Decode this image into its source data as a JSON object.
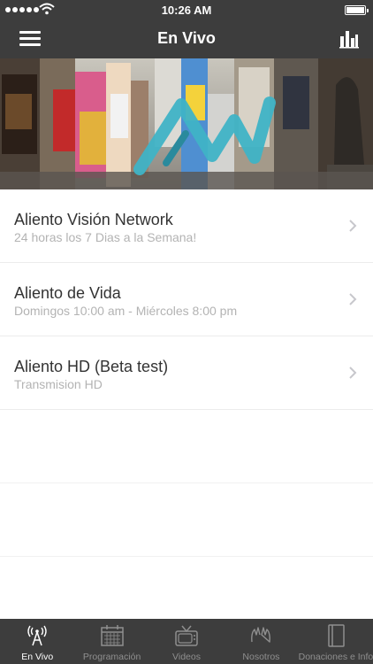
{
  "status_bar": {
    "time": "10:26 AM"
  },
  "nav": {
    "title": "En Vivo"
  },
  "channels": [
    {
      "title": "Aliento Visión Network",
      "subtitle": "24 horas los 7 Dias a la Semana!"
    },
    {
      "title": "Aliento de Vida",
      "subtitle": "Domingos 10:00 am - Miércoles 8:00 pm"
    },
    {
      "title": "Aliento HD (Beta test)",
      "subtitle": "Transmision HD"
    }
  ],
  "tabs": [
    {
      "label": "En Vivo",
      "icon": "antenna-icon",
      "active": true
    },
    {
      "label": "Programación",
      "icon": "calendar-icon",
      "active": false
    },
    {
      "label": "Videos",
      "icon": "tv-icon",
      "active": false
    },
    {
      "label": "Nosotros",
      "icon": "hands-icon",
      "active": false
    },
    {
      "label": "Donaciones e Info",
      "icon": "book-icon",
      "active": false
    }
  ],
  "colors": {
    "bar": "#3d3d3d",
    "logo": "#3fb3c6",
    "active_tab": "#ffffff",
    "inactive_tab": "#8f8f8f"
  }
}
